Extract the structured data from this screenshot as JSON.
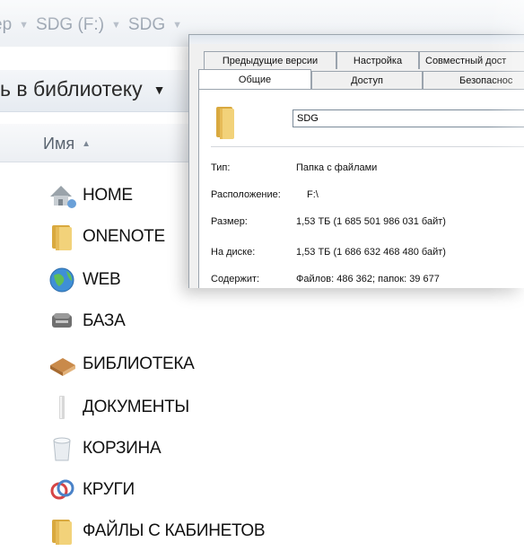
{
  "breadcrumb": {
    "items": [
      "ер",
      "SDG (F:)",
      "SDG"
    ]
  },
  "toolbar": {
    "include_in_library_label": "ь в библиотеку"
  },
  "column_header": {
    "name_label": "Имя"
  },
  "files": [
    {
      "name": "HOME",
      "icon": "home-network-icon"
    },
    {
      "name": "ONENOTE",
      "icon": "folder-icon"
    },
    {
      "name": "WEB",
      "icon": "globe-icon"
    },
    {
      "name": "БАЗА",
      "icon": "database-icon"
    },
    {
      "name": "БИБЛИОТЕКА",
      "icon": "books-icon"
    },
    {
      "name": "ДОКУМЕНТЫ",
      "icon": "document-icon"
    },
    {
      "name": "КОРЗИНА",
      "icon": "recycle-bin-icon"
    },
    {
      "name": "КРУГИ",
      "icon": "circles-icon"
    },
    {
      "name": "ФАЙЛЫ С КАБИНЕТОВ",
      "icon": "folder-icon"
    }
  ],
  "dialog": {
    "tabs_top": [
      "Предыдущие версии",
      "Настройка",
      "Совместный дост"
    ],
    "tabs_bottom": [
      "Общие",
      "Доступ",
      "Безопаснос"
    ],
    "folder_name": "SDG",
    "properties": [
      {
        "label": "Тип:",
        "value": "Папка с файлами"
      },
      {
        "label": "Расположение:",
        "value": "F:\\"
      },
      {
        "label": "Размер:",
        "value": "1,53 ТБ (1 685 501 986 031 байт)"
      },
      {
        "label": "На диске:",
        "value": "1,53 ТБ (1 686 632 468 480 байт)"
      },
      {
        "label": "Содержит:",
        "value": "Файлов: 486 362; папок: 39 677"
      }
    ]
  },
  "colors": {
    "folder_yellow": "#e8c25a",
    "dialog_bg": "#f0f0f0",
    "border": "#9aa3ad"
  }
}
